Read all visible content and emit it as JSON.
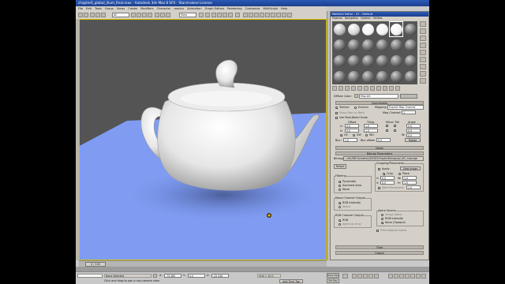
{
  "window": {
    "title": "chapter6_global_illum_final.max - Autodesk 3ds Max 8 SP3 - Stand-alone License"
  },
  "menu": [
    "File",
    "Edit",
    "Tools",
    "Group",
    "Views",
    "Create",
    "Modifiers",
    "Character",
    "reactor",
    "Animation",
    "Graph Editors",
    "Rendering",
    "Customize",
    "MAXScript",
    "Help"
  ],
  "toolbar": {
    "selection_filter": "All",
    "reference_coord": "View"
  },
  "viewport": {
    "label": "Perspective",
    "background": "#545454",
    "plane_color": "#7f9cf2"
  },
  "material_editor": {
    "title": "Material Editor - 01 - Default",
    "menu": [
      "Material",
      "Navigation",
      "Options",
      "Utilities"
    ],
    "diffuse_label": "Diffuse Color:",
    "map_name": "Map #4",
    "coordinates": {
      "rollout": "Coordinates",
      "texture": "Texture",
      "environ": "Environ",
      "mapping_label": "Mapping:",
      "mapping_value": "Explicit Map Channel",
      "show_map_on_back": "Show Map on Back",
      "map_channel_label": "Map Channel:",
      "map_channel_value": "1",
      "real_world": "Use Real-World Scale",
      "col_offset": "Offset",
      "col_tiling": "Tiling",
      "col_mirror_tile": "Mirror Tile",
      "col_angle": "Angle",
      "u_label": "U:",
      "v_label": "V:",
      "u_offset": "0.0",
      "v_offset": "0.0",
      "u_tiling": "1.0",
      "v_tiling": "1.0",
      "u_angle": "0.0",
      "v_angle": "0.0",
      "w_angle": "0.0",
      "uv": "UV",
      "vw": "VW",
      "wu": "WU",
      "w_label": "W:",
      "blur_label": "Blur:",
      "blur_value": "1.0",
      "blur_offset_label": "Blur offset:",
      "blur_offset_value": "0.0",
      "rotate": "Rotate"
    },
    "noise_rollout": "Noise",
    "bitmap_params": {
      "rollout": "Bitmap Parameters",
      "bitmap_label": "Bitmap:",
      "bitmap_path": "...als\\3DS Academy\\DVD2\\Chapter6\\maps\\pi_AO_map.tga",
      "reload": "Reload",
      "cropping_label": "Cropping/Placement",
      "apply": "Apply",
      "view_image": "View Image",
      "crop": "Crop",
      "place": "Place",
      "u_label": "U:",
      "u_value": "0.0",
      "w_label": "W:",
      "w_value": "1.0",
      "v_label": "V:",
      "v_value": "0.0",
      "h_label": "H:",
      "h_value": "1.0",
      "jitter_label": "Jitter Placement:",
      "jitter_value": "1.0",
      "filtering_label": "Filtering",
      "pyramidal": "Pyramidal",
      "summed_area": "Summed Area",
      "none": "None",
      "mono_label": "Mono Channel Output:",
      "rgb_intensity": "RGB Intensity",
      "alpha": "Alpha",
      "rgb_channel_label": "RGB Channel Output:",
      "rgb": "RGB",
      "alpha_as_gray": "Alpha as Gray",
      "alpha_source_label": "Alpha Source",
      "image_alpha": "Image Alpha",
      "rgb_intensity2": "RGB Intensity",
      "none_opaque": "None (Opaque)",
      "premult": "Premultiplied Alpha"
    },
    "time_rollout": "Time",
    "output_rollout": "Output"
  },
  "time_slider": "0 / 100",
  "status": {
    "selection": "None Selected",
    "prompt": "Click and drag to pan a non-camera view",
    "x_label": "X:",
    "x_value": "-75.385",
    "y_label": "Y:",
    "y_value": "0.0",
    "z_label": "Z:",
    "z_value": "-25.546",
    "grid": "Grid = 10.0",
    "auto_key": "Auto Key",
    "add_time_tag": "Add Time Tag",
    "set_key": "Set Key"
  }
}
